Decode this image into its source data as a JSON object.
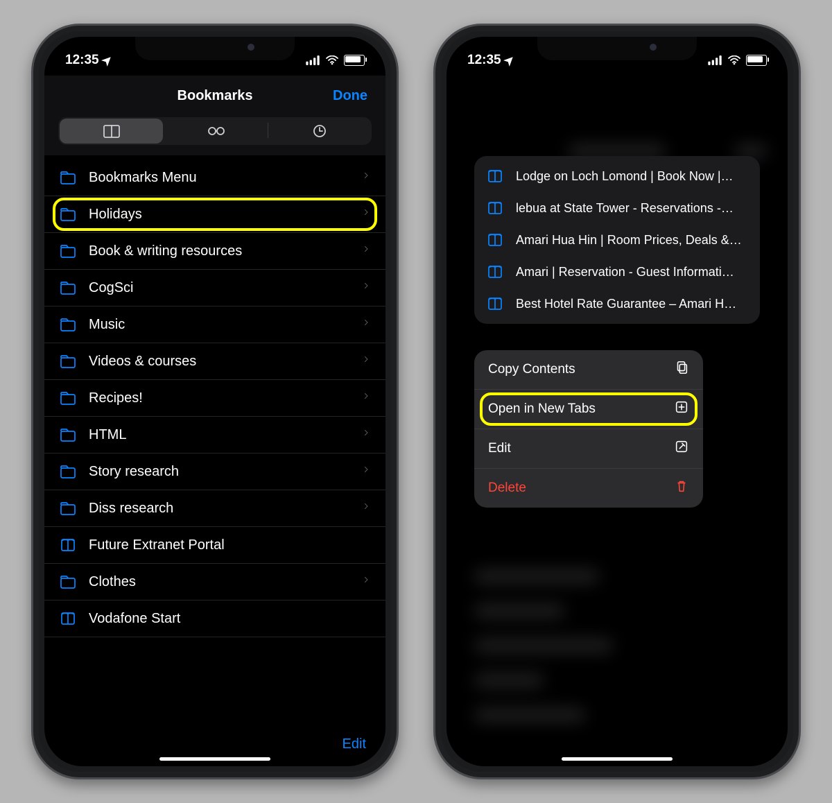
{
  "status": {
    "time": "12:35"
  },
  "left": {
    "title": "Bookmarks",
    "done": "Done",
    "edit": "Edit",
    "items": [
      {
        "icon": "folder",
        "label": "Bookmarks Menu",
        "chevron": true
      },
      {
        "icon": "folder",
        "label": "Holidays",
        "chevron": true,
        "highlight": true
      },
      {
        "icon": "folder",
        "label": "Book & writing resources",
        "chevron": true
      },
      {
        "icon": "folder",
        "label": "CogSci",
        "chevron": true
      },
      {
        "icon": "folder",
        "label": "Music",
        "chevron": true
      },
      {
        "icon": "folder",
        "label": "Videos & courses",
        "chevron": true
      },
      {
        "icon": "folder",
        "label": "Recipes!",
        "chevron": true
      },
      {
        "icon": "folder",
        "label": "HTML",
        "chevron": true
      },
      {
        "icon": "folder",
        "label": "Story research",
        "chevron": true
      },
      {
        "icon": "folder",
        "label": "Diss research",
        "chevron": true
      },
      {
        "icon": "book",
        "label": "Future Extranet Portal",
        "chevron": false
      },
      {
        "icon": "folder",
        "label": "Clothes",
        "chevron": true
      },
      {
        "icon": "book",
        "label": "Vodafone Start",
        "chevron": false
      }
    ]
  },
  "right": {
    "preview": [
      "Lodge on Loch Lomond | Book Now |…",
      "lebua at State Tower - Reservations -…",
      "Amari Hua Hin | Room Prices, Deals &…",
      "Amari | Reservation - Guest Informati…",
      "Best Hotel Rate Guarantee – Amari H…"
    ],
    "menu": [
      {
        "label": "Copy Contents",
        "icon": "copy"
      },
      {
        "label": "Open in New Tabs",
        "icon": "newtab",
        "highlight": true
      },
      {
        "label": "Edit",
        "icon": "edit"
      },
      {
        "label": "Delete",
        "icon": "trash",
        "destructive": true
      }
    ]
  }
}
